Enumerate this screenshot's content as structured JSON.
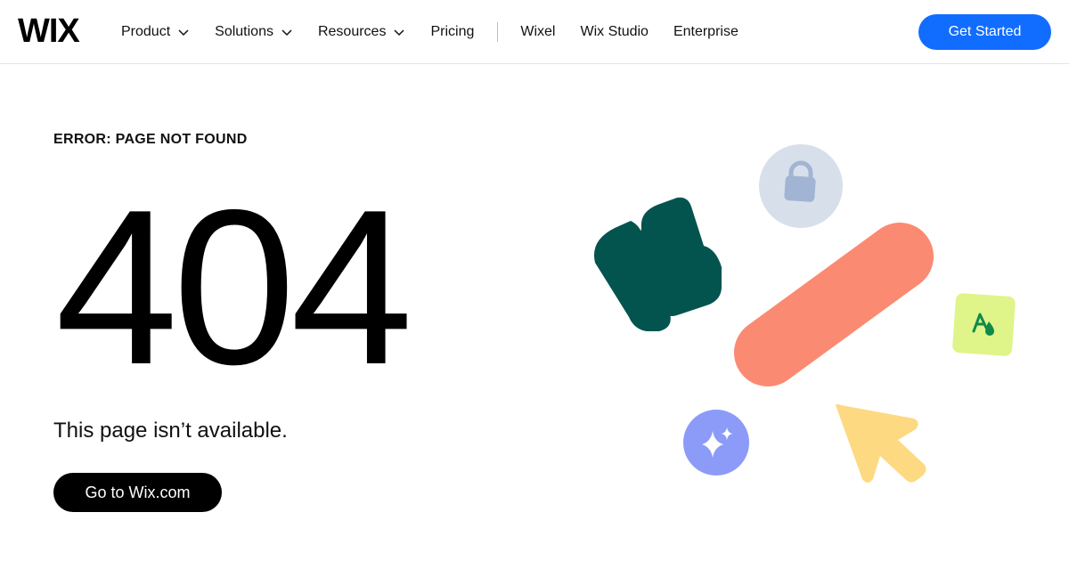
{
  "header": {
    "logo_text": "WIX",
    "nav": [
      {
        "label": "Product",
        "has_dropdown": true
      },
      {
        "label": "Solutions",
        "has_dropdown": true
      },
      {
        "label": "Resources",
        "has_dropdown": true
      },
      {
        "label": "Pricing",
        "has_dropdown": false
      },
      {
        "label": "Wixel",
        "has_dropdown": false
      },
      {
        "label": "Wix Studio",
        "has_dropdown": false
      },
      {
        "label": "Enterprise",
        "has_dropdown": false
      }
    ],
    "cta_label": "Get Started"
  },
  "main": {
    "error_label": "ERROR: PAGE NOT FOUND",
    "code": "404",
    "message": "This page isn’t available.",
    "button_label": "Go to Wix.com"
  },
  "illustration": {
    "icons": [
      "lock-icon",
      "puzzle-shape-icon",
      "pill-bar-icon",
      "font-color-icon",
      "sparkle-icon",
      "cursor-arrow-icon"
    ]
  },
  "colors": {
    "accent": "#116dff",
    "teal": "#03544f",
    "coral": "#fb8a72",
    "lock_circle": "#d7e0ea",
    "lock_fill": "#a2b4d4",
    "lime": "#dff489",
    "periwinkle": "#8c9bf7",
    "yellow": "#fdd982"
  }
}
